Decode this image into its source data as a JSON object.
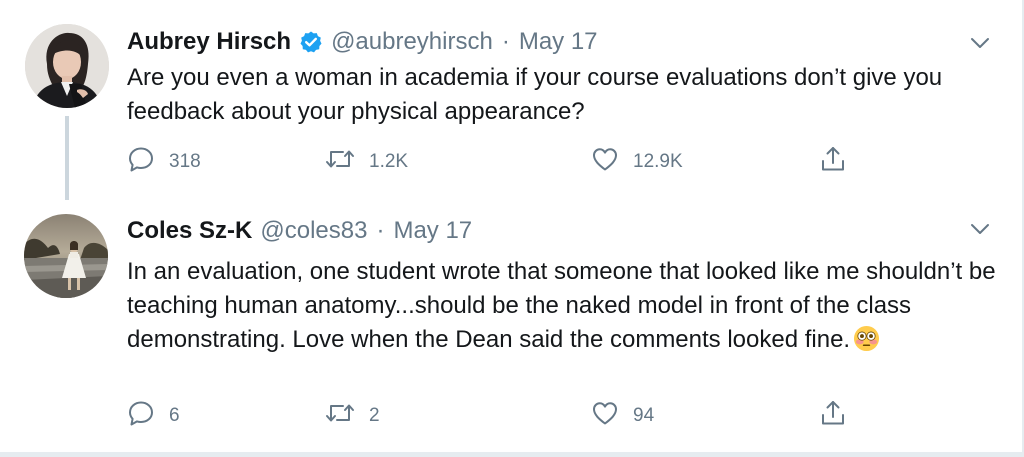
{
  "tweets": [
    {
      "display_name": "Aubrey Hirsch",
      "verified": true,
      "handle": "@aubreyhirsch",
      "separator": "·",
      "date": "May 17",
      "text": "Are you even a woman in academia if your course evaluations don’t give you feedback about your physical appearance?",
      "replies": "318",
      "retweets": "1.2K",
      "likes": "12.9K"
    },
    {
      "display_name": "Coles Sz-K",
      "verified": false,
      "handle": "@coles83",
      "separator": "·",
      "date": "May 17",
      "text": "In an evaluation, one student wrote that someone that looked like me shouldn’t be teaching human anatomy...should be the naked model in front of the class demonstrating. Love when the Dean said the comments looked fine.",
      "emoji": "flushed-face",
      "replies": "6",
      "retweets": "2",
      "likes": "94"
    }
  ],
  "colors": {
    "verified": "#1da1f2",
    "secondary_text": "#657786",
    "thread_line": "#ccd6dd"
  },
  "icons": [
    "verified-badge-icon",
    "chevron-down-icon",
    "reply-icon",
    "retweet-icon",
    "like-icon",
    "share-icon"
  ]
}
